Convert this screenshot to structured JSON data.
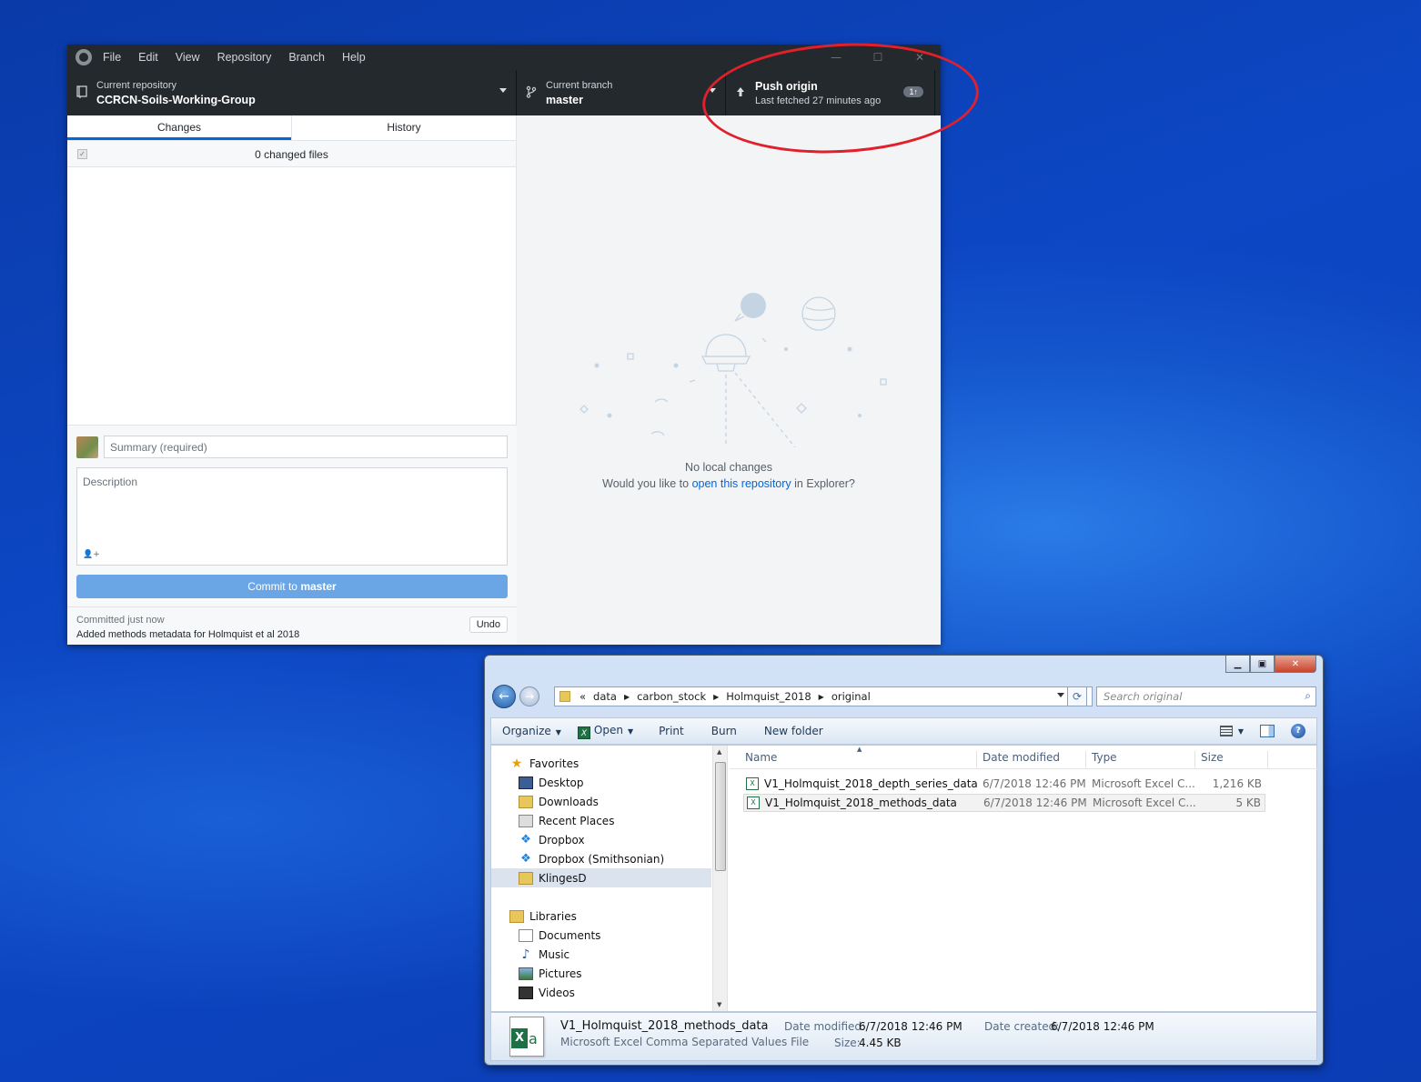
{
  "github_desktop": {
    "menu": [
      "File",
      "Edit",
      "View",
      "Repository",
      "Branch",
      "Help"
    ],
    "window_controls": {
      "minimize": "—",
      "maximize": "☐",
      "close": "✕"
    },
    "repository": {
      "label": "Current repository",
      "name": "CCRCN-Soils-Working-Group"
    },
    "branch": {
      "label": "Current branch",
      "name": "master"
    },
    "push": {
      "title": "Push origin",
      "subtitle": "Last fetched 27 minutes ago",
      "badge": "1↑"
    },
    "tabs": {
      "changes": "Changes",
      "history": "History"
    },
    "changed_files": "0 changed files",
    "summary_placeholder": "Summary (required)",
    "description_placeholder": "Description",
    "commit_button": {
      "prefix": "Commit to",
      "branch": "master"
    },
    "last_commit": {
      "time": "Committed just now",
      "message": "Added methods metadata for Holmquist et al 2018",
      "undo_label": "Undo"
    },
    "no_changes": {
      "title": "No local changes",
      "prompt_before": "Would you like to",
      "link": "open this repository",
      "prompt_after": "in Explorer?"
    },
    "highlight_color": "#e0202a"
  },
  "explorer": {
    "address": {
      "prefix": "«",
      "crumbs": [
        "data",
        "carbon_stock",
        "Holmquist_2018",
        "original"
      ]
    },
    "search_placeholder": "Search original",
    "commands": {
      "organize": "Organize",
      "open": "Open",
      "print": "Print",
      "burn": "Burn",
      "new_folder": "New folder"
    },
    "nav": {
      "favorites": "Favorites",
      "favorite_items": [
        "Desktop",
        "Downloads",
        "Recent Places",
        "Dropbox",
        "Dropbox (Smithsonian)",
        "KlingesD"
      ],
      "libraries": "Libraries",
      "library_items": [
        "Documents",
        "Music",
        "Pictures",
        "Videos"
      ]
    },
    "columns": {
      "name": "Name",
      "date": "Date modified",
      "type": "Type",
      "size": "Size"
    },
    "files": [
      {
        "name": "V1_Holmquist_2018_depth_series_data",
        "date": "6/7/2018 12:46 PM",
        "type": "Microsoft Excel C...",
        "size": "1,216 KB"
      },
      {
        "name": "V1_Holmquist_2018_methods_data",
        "date": "6/7/2018 12:46 PM",
        "type": "Microsoft Excel C...",
        "size": "5 KB"
      }
    ],
    "details": {
      "name": "V1_Holmquist_2018_methods_data",
      "type": "Microsoft Excel Comma Separated Values File",
      "modified_label": "Date modified:",
      "modified": "6/7/2018 12:46 PM",
      "created_label": "Date created:",
      "created": "6/7/2018 12:46 PM",
      "size_label": "Size:",
      "size": "4.45 KB"
    }
  }
}
